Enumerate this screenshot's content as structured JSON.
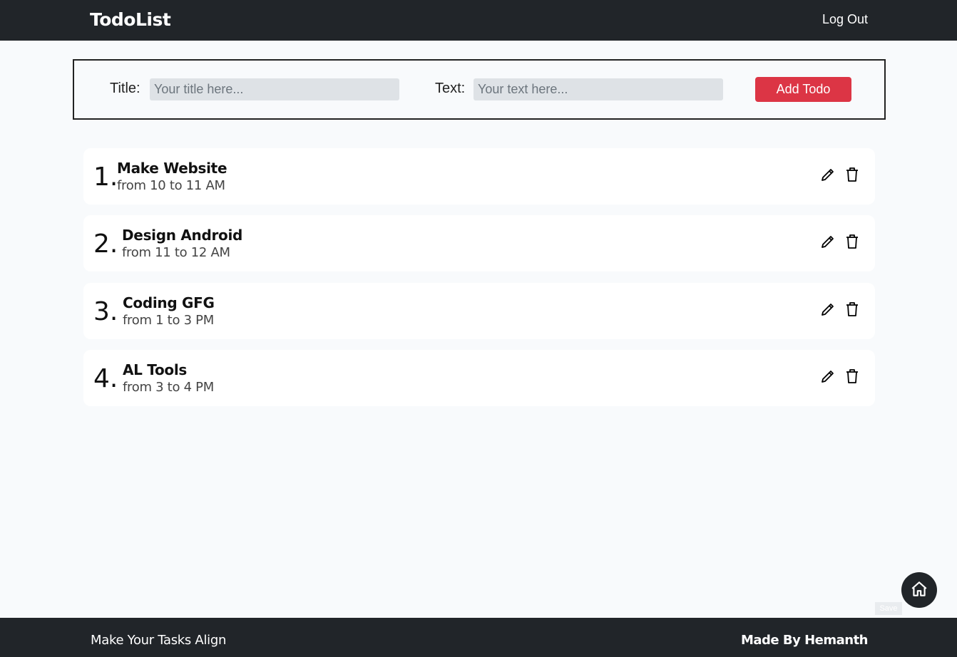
{
  "navbar": {
    "brand": "TodoList",
    "logout_label": "Log Out"
  },
  "form": {
    "title_label": "Title:",
    "title_placeholder": "Your title here...",
    "text_label": "Text:",
    "text_placeholder": "Your text here...",
    "add_label": "Add Todo"
  },
  "todos": [
    {
      "num": "1.",
      "title": "Make Website",
      "text": "from 10 to 11 AM"
    },
    {
      "num": "2.",
      "title": "Design Android",
      "text": "from 11 to 12 AM"
    },
    {
      "num": "3.",
      "title": "Coding GFG",
      "text": "from 1 to 3 PM"
    },
    {
      "num": "4.",
      "title": "AL Tools",
      "text": "from 3 to 4 PM"
    }
  ],
  "icons": {
    "edit": "pencil-icon",
    "delete": "trash-icon",
    "home": "home-icon"
  },
  "footer": {
    "left": "Make Your Tasks Align",
    "right": "Made By Hemanth"
  },
  "save_tag": "Save",
  "colors": {
    "nav_bg": "#212529",
    "add_button": "#dc3545",
    "page_bg": "#f8fafc"
  }
}
